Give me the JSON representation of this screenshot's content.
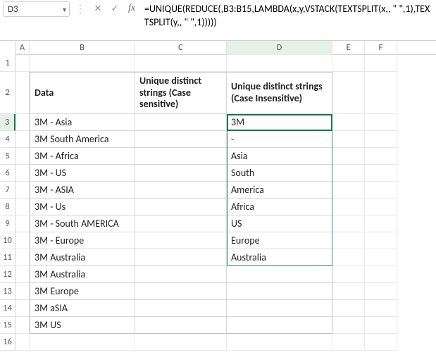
{
  "name_box": "D3",
  "formula": "=UNIQUE(REDUCE(,B3:B15,LAMBDA(x,y,VSTACK(TEXTSPLIT(x,, \" \",1),TEXTSPLIT(y,, \" \",1)))))",
  "columns": [
    "A",
    "B",
    "C",
    "D",
    "E",
    "F"
  ],
  "rows": [
    "1",
    "2",
    "3",
    "4",
    "5",
    "6",
    "7",
    "8",
    "9",
    "10",
    "11",
    "12",
    "13",
    "14",
    "15",
    "16"
  ],
  "headers": {
    "b2": "Data",
    "c2": "Unique distinct strings\n(Case sensitive)",
    "d2": "Unique distinct strings\n(Case Insensitive)"
  },
  "dataB": [
    "3M - Asia",
    "3M  South America",
    "3M - Africa",
    "3M - US",
    "3M - ASIA",
    "3M - Us",
    "3M - South AMERICA",
    "3M - Europe",
    "3M Australia",
    "3M Australia",
    "3M Europe",
    "3M aSIA",
    "3M US"
  ],
  "dataD": [
    "3M",
    "-",
    "Asia",
    "South",
    "America",
    "Africa",
    "US",
    "Europe",
    "Australia"
  ],
  "chart_data": {
    "type": "table",
    "title": "Unique distinct strings extraction",
    "columns": [
      "Data",
      "Unique distinct strings (Case sensitive)",
      "Unique distinct strings (Case Insensitive)"
    ],
    "rows": [
      [
        "3M - Asia",
        "",
        "3M"
      ],
      [
        "3M  South America",
        "",
        "-"
      ],
      [
        "3M - Africa",
        "",
        "Asia"
      ],
      [
        "3M - US",
        "",
        "South"
      ],
      [
        "3M - ASIA",
        "",
        "America"
      ],
      [
        "3M - Us",
        "",
        "Africa"
      ],
      [
        "3M - South AMERICA",
        "",
        "US"
      ],
      [
        "3M - Europe",
        "",
        "Europe"
      ],
      [
        "3M Australia",
        "",
        "Australia"
      ],
      [
        "3M Australia",
        "",
        ""
      ],
      [
        "3M Europe",
        "",
        ""
      ],
      [
        "3M aSIA",
        "",
        ""
      ],
      [
        "3M US",
        "",
        ""
      ]
    ]
  }
}
